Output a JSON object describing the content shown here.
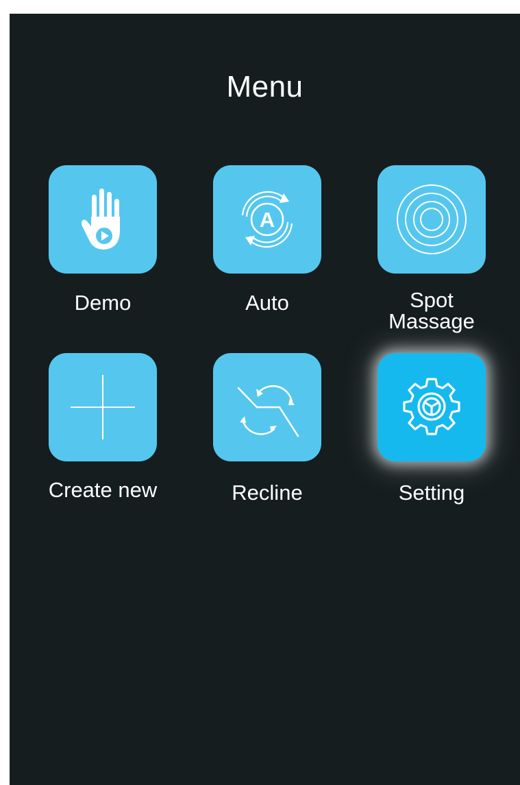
{
  "screen": {
    "title": "Menu"
  },
  "menu": {
    "items": [
      {
        "id": "demo",
        "label": "Demo",
        "icon": "hand-play-icon",
        "selected": false
      },
      {
        "id": "auto",
        "label": "Auto",
        "icon": "auto-cycle-icon",
        "selected": false
      },
      {
        "id": "spot",
        "label_line1": "Spot",
        "label_line2": "Massage",
        "icon": "concentric-circles-icon",
        "selected": false
      },
      {
        "id": "create",
        "label": "Create new",
        "icon": "plus-icon",
        "selected": false
      },
      {
        "id": "recline",
        "label": "Recline",
        "icon": "recline-arrows-icon",
        "selected": false
      },
      {
        "id": "setting",
        "label": "Setting",
        "icon": "gear-icon",
        "selected": true
      }
    ]
  },
  "colors": {
    "background": "#161d1f",
    "tile": "#55c7ee",
    "tile_selected": "#15b9ed",
    "text": "#ffffff"
  }
}
